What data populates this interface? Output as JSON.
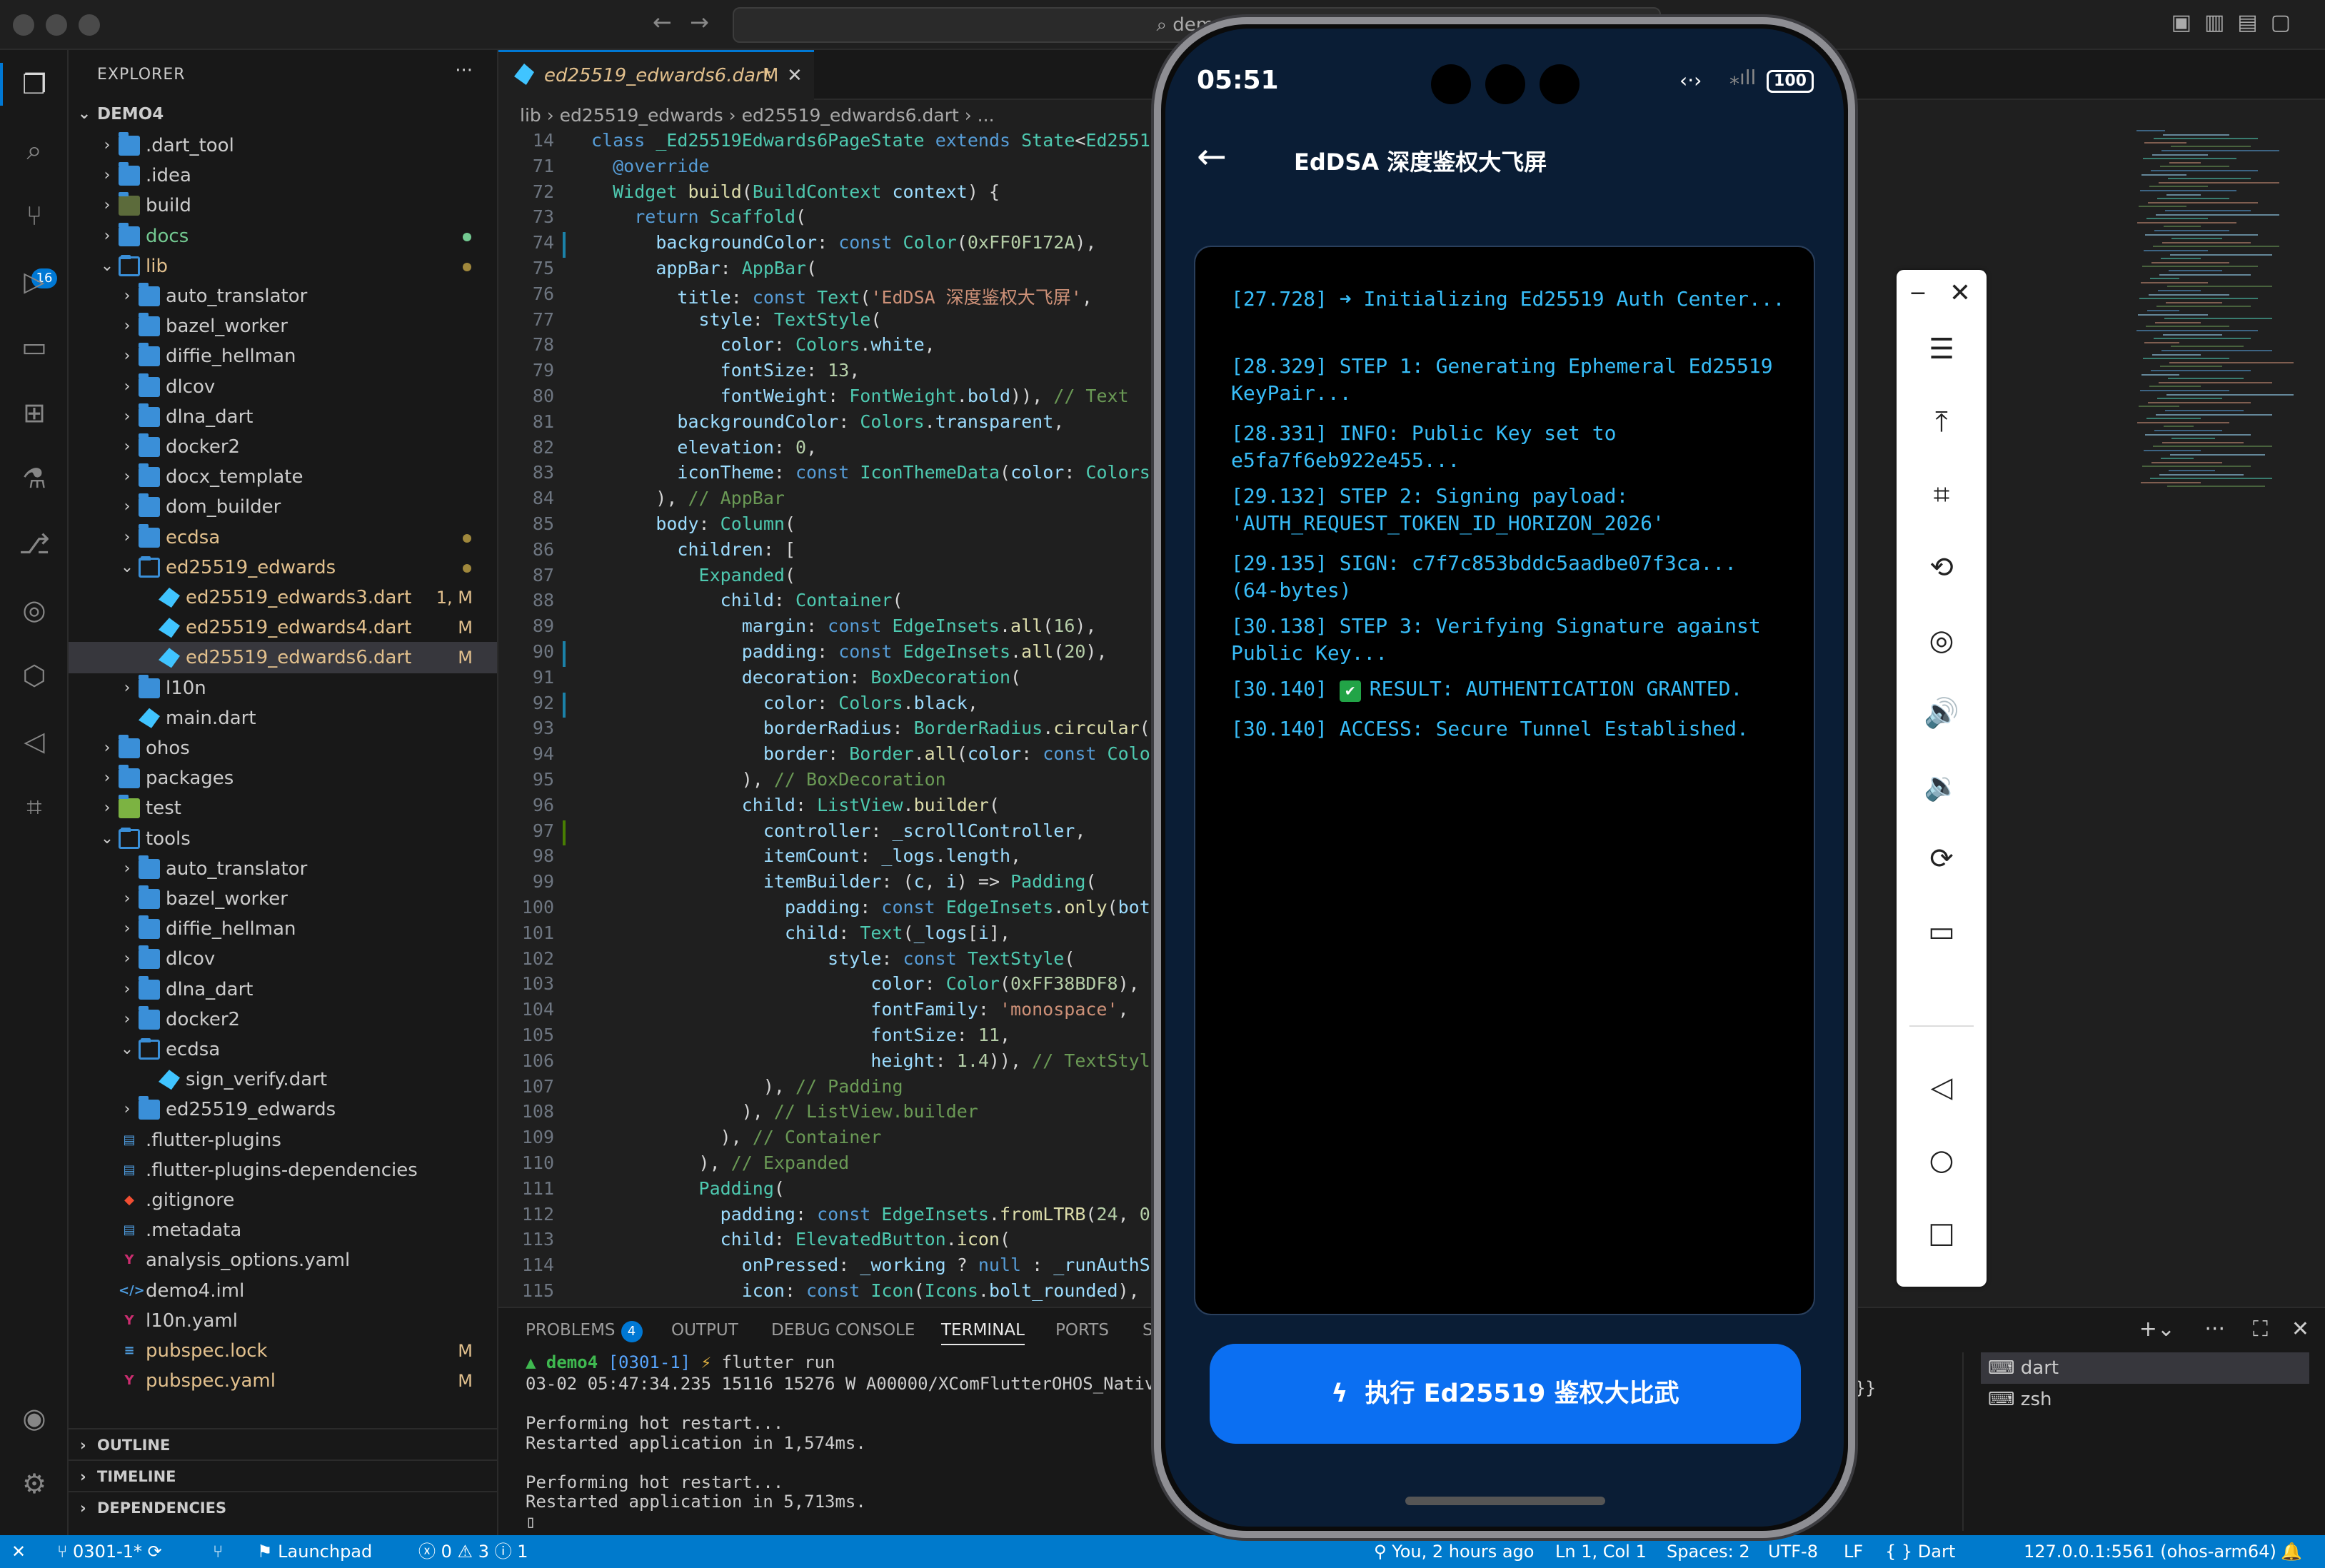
{
  "titlebar": {
    "search_text": "demo4"
  },
  "activity": {
    "scm_badge": "16"
  },
  "explorer": {
    "title": "EXPLORER",
    "root": "DEMO4",
    "items": [
      {
        "label": ".dart_tool",
        "indent": 1,
        "kind": "folder",
        "open": false
      },
      {
        "label": ".idea",
        "indent": 1,
        "kind": "folder",
        "open": false
      },
      {
        "label": "build",
        "indent": 1,
        "kind": "folder-build",
        "open": false
      },
      {
        "label": "docs",
        "indent": 1,
        "kind": "folder",
        "open": false,
        "dot": "#73c991",
        "color": "#73c991"
      },
      {
        "label": "lib",
        "indent": 1,
        "kind": "folder",
        "open": true,
        "dot": "#a0883c",
        "color": "#e2c08d"
      },
      {
        "label": "auto_translator",
        "indent": 2,
        "kind": "folder",
        "open": false
      },
      {
        "label": "bazel_worker",
        "indent": 2,
        "kind": "folder",
        "open": false
      },
      {
        "label": "diffie_hellman",
        "indent": 2,
        "kind": "folder",
        "open": false
      },
      {
        "label": "dlcov",
        "indent": 2,
        "kind": "folder",
        "open": false
      },
      {
        "label": "dlna_dart",
        "indent": 2,
        "kind": "folder",
        "open": false
      },
      {
        "label": "docker2",
        "indent": 2,
        "kind": "folder",
        "open": false
      },
      {
        "label": "docx_template",
        "indent": 2,
        "kind": "folder",
        "open": false
      },
      {
        "label": "dom_builder",
        "indent": 2,
        "kind": "folder",
        "open": false
      },
      {
        "label": "ecdsa",
        "indent": 2,
        "kind": "folder",
        "open": false,
        "dot": "#a0883c",
        "color": "#e2c08d"
      },
      {
        "label": "ed25519_edwards",
        "indent": 2,
        "kind": "folder",
        "open": true,
        "dot": "#a0883c",
        "color": "#e2c08d"
      },
      {
        "label": "ed25519_edwards3.dart",
        "indent": 3,
        "kind": "dart",
        "status": "1, M",
        "color": "#e2c08d"
      },
      {
        "label": "ed25519_edwards4.dart",
        "indent": 3,
        "kind": "dart",
        "status": "M",
        "color": "#e2c08d"
      },
      {
        "label": "ed25519_edwards6.dart",
        "indent": 3,
        "kind": "dart",
        "status": "M",
        "color": "#e2c08d",
        "selected": true
      },
      {
        "label": "l10n",
        "indent": 2,
        "kind": "folder",
        "open": false
      },
      {
        "label": "main.dart",
        "indent": 2,
        "kind": "dart"
      },
      {
        "label": "ohos",
        "indent": 1,
        "kind": "folder",
        "open": false
      },
      {
        "label": "packages",
        "indent": 1,
        "kind": "folder",
        "open": false
      },
      {
        "label": "test",
        "indent": 1,
        "kind": "folder-test",
        "open": false
      },
      {
        "label": "tools",
        "indent": 1,
        "kind": "folder",
        "open": true
      },
      {
        "label": "auto_translator",
        "indent": 2,
        "kind": "folder",
        "open": false
      },
      {
        "label": "bazel_worker",
        "indent": 2,
        "kind": "folder",
        "open": false
      },
      {
        "label": "diffie_hellman",
        "indent": 2,
        "kind": "folder",
        "open": false
      },
      {
        "label": "dlcov",
        "indent": 2,
        "kind": "folder",
        "open": false
      },
      {
        "label": "dlna_dart",
        "indent": 2,
        "kind": "folder",
        "open": false
      },
      {
        "label": "docker2",
        "indent": 2,
        "kind": "folder",
        "open": false
      },
      {
        "label": "ecdsa",
        "indent": 2,
        "kind": "folder",
        "open": true
      },
      {
        "label": "sign_verify.dart",
        "indent": 3,
        "kind": "dart"
      },
      {
        "label": "ed25519_edwards",
        "indent": 2,
        "kind": "folder",
        "open": false
      },
      {
        "label": ".flutter-plugins",
        "indent": 1,
        "kind": "file"
      },
      {
        "label": ".flutter-plugins-dependencies",
        "indent": 1,
        "kind": "file"
      },
      {
        "label": ".gitignore",
        "indent": 1,
        "kind": "git"
      },
      {
        "label": ".metadata",
        "indent": 1,
        "kind": "file"
      },
      {
        "label": "analysis_options.yaml",
        "indent": 1,
        "kind": "yaml"
      },
      {
        "label": "demo4.iml",
        "indent": 1,
        "kind": "xml"
      },
      {
        "label": "l10n.yaml",
        "indent": 1,
        "kind": "yaml"
      },
      {
        "label": "pubspec.lock",
        "indent": 1,
        "kind": "lock",
        "status": "M",
        "color": "#e2c08d"
      },
      {
        "label": "pubspec.yaml",
        "indent": 1,
        "kind": "yaml",
        "status": "M",
        "color": "#e2c08d"
      }
    ],
    "sections": [
      "OUTLINE",
      "TIMELINE",
      "DEPENDENCIES"
    ]
  },
  "editor": {
    "tab_label": "ed25519_edwards6.dart",
    "tab_status": "M",
    "breadcrumb": [
      "lib",
      "ed25519_edwards",
      "ed25519_edwards6.dart",
      "..."
    ],
    "sticky_line": {
      "no": "14",
      "html": "<span class=\"kw\">class</span> <span class=\"ty\">_Ed25519Edwards6PageState</span> <span class=\"kw\">extends</span> <span class=\"ty\">State</span>&lt;<span class=\"ty\">Ed25519E</span>"
    },
    "lines": [
      {
        "no": "71",
        "html": "  <span class=\"an\">@override</span>"
      },
      {
        "no": "72",
        "html": "  <span class=\"ty\">Widget</span> <span class=\"fn\">build</span>(<span class=\"ty\">BuildContext</span> <span class=\"pr\">context</span>) {"
      },
      {
        "no": "73",
        "html": "    <span class=\"kw\">return</span> <span class=\"ty\">Scaffold</span>("
      },
      {
        "no": "74",
        "html": "      <span class=\"pr\">backgroundColor</span>: <span class=\"kw\">const</span> <span class=\"ty\">Color</span>(<span class=\"nm\">0xFF0F172A</span>),"
      },
      {
        "no": "75",
        "html": "      <span class=\"pr\">appBar</span>: <span class=\"ty\">AppBar</span>("
      },
      {
        "no": "76",
        "html": "        <span class=\"pr\">title</span>: <span class=\"kw\">const</span> <span class=\"ty\">Text</span>(<span class=\"str\">'EdDSA 深度鉴权大飞屏'</span>,"
      },
      {
        "no": "77",
        "html": "          <span class=\"pr\">style</span>: <span class=\"ty\">TextStyle</span>("
      },
      {
        "no": "78",
        "html": "            <span class=\"pr\">color</span>: <span class=\"ty\">Colors</span>.<span class=\"pr\">white</span>,"
      },
      {
        "no": "79",
        "html": "            <span class=\"pr\">fontSize</span>: <span class=\"nm\">13</span>,"
      },
      {
        "no": "80",
        "html": "            <span class=\"pr\">fontWeight</span>: <span class=\"ty\">FontWeight</span>.<span class=\"pr\">bold</span>)), <span class=\"cm\">// Text</span>"
      },
      {
        "no": "81",
        "html": "        <span class=\"pr\">backgroundColor</span>: <span class=\"ty\">Colors</span>.<span class=\"pr\">transparent</span>,"
      },
      {
        "no": "82",
        "html": "        <span class=\"pr\">elevation</span>: <span class=\"nm\">0</span>,"
      },
      {
        "no": "83",
        "html": "        <span class=\"pr\">iconTheme</span>: <span class=\"kw\">const</span> <span class=\"ty\">IconThemeData</span>(<span class=\"pr\">color</span>: <span class=\"ty\">Colors</span>."
      },
      {
        "no": "84",
        "html": "      ), <span class=\"cm\">// AppBar</span>"
      },
      {
        "no": "85",
        "html": "      <span class=\"pr\">body</span>: <span class=\"ty\">Column</span>("
      },
      {
        "no": "86",
        "html": "        <span class=\"pr\">children</span>: ["
      },
      {
        "no": "87",
        "html": "          <span class=\"ty\">Expanded</span>("
      },
      {
        "no": "88",
        "html": "            <span class=\"pr\">child</span>: <span class=\"ty\">Container</span>("
      },
      {
        "no": "89",
        "html": "              <span class=\"pr\">margin</span>: <span class=\"kw\">const</span> <span class=\"ty\">EdgeInsets</span>.<span class=\"fn\">all</span>(<span class=\"nm\">16</span>),"
      },
      {
        "no": "90",
        "html": "              <span class=\"pr\">padding</span>: <span class=\"kw\">const</span> <span class=\"ty\">EdgeInsets</span>.<span class=\"fn\">all</span>(<span class=\"nm\">20</span>),"
      },
      {
        "no": "91",
        "html": "              <span class=\"pr\">decoration</span>: <span class=\"ty\">BoxDecoration</span>("
      },
      {
        "no": "92",
        "html": "                <span class=\"pr\">color</span>: <span class=\"ty\">Colors</span>.<span class=\"pr\">black</span>,"
      },
      {
        "no": "93",
        "html": "                <span class=\"pr\">borderRadius</span>: <span class=\"ty\">BorderRadius</span>.<span class=\"fn\">circular</span>(<span class=\"nm\">12</span>"
      },
      {
        "no": "94",
        "html": "                <span class=\"pr\">border</span>: <span class=\"ty\">Border</span>.<span class=\"fn\">all</span>(<span class=\"pr\">color</span>: <span class=\"kw\">const</span> <span class=\"ty\">Colo</span>"
      },
      {
        "no": "95",
        "html": "              ), <span class=\"cm\">// BoxDecoration</span>"
      },
      {
        "no": "96",
        "html": "              <span class=\"pr\">child</span>: <span class=\"ty\">ListView</span>.<span class=\"fn\">builder</span>("
      },
      {
        "no": "97",
        "html": "                <span class=\"pr\">controller</span>: <span class=\"pr\">_scrollController</span>,"
      },
      {
        "no": "98",
        "html": "                <span class=\"pr\">itemCount</span>: <span class=\"pr\">_logs</span>.<span class=\"pr\">length</span>,"
      },
      {
        "no": "99",
        "html": "                <span class=\"pr\">itemBuilder</span>: (<span class=\"pr\">c</span>, <span class=\"pr\">i</span>) =&gt; <span class=\"ty\">Padding</span>("
      },
      {
        "no": "100",
        "html": "                  <span class=\"pr\">padding</span>: <span class=\"kw\">const</span> <span class=\"ty\">EdgeInsets</span>.<span class=\"fn\">only</span>(<span class=\"pr\">bottom</span>"
      },
      {
        "no": "101",
        "html": "                  <span class=\"pr\">child</span>: <span class=\"ty\">Text</span>(<span class=\"pr\">_logs</span>[<span class=\"pr\">i</span>],"
      },
      {
        "no": "102",
        "html": "                      <span class=\"pr\">style</span>: <span class=\"kw\">const</span> <span class=\"ty\">TextStyle</span>("
      },
      {
        "no": "103",
        "html": "                          <span class=\"pr\">color</span>: <span class=\"ty\">Color</span>(<span class=\"nm\">0xFF38BDF8</span>),"
      },
      {
        "no": "104",
        "html": "                          <span class=\"pr\">fontFamily</span>: <span class=\"str\">'monospace'</span>,"
      },
      {
        "no": "105",
        "html": "                          <span class=\"pr\">fontSize</span>: <span class=\"nm\">11</span>,"
      },
      {
        "no": "106",
        "html": "                          <span class=\"pr\">height</span>: <span class=\"nm\">1.4</span>)), <span class=\"cm\">// TextStyle</span>"
      },
      {
        "no": "107",
        "html": "                ), <span class=\"cm\">// Padding</span>"
      },
      {
        "no": "108",
        "html": "              ), <span class=\"cm\">// ListView.builder</span>"
      },
      {
        "no": "109",
        "html": "            ), <span class=\"cm\">// Container</span>"
      },
      {
        "no": "110",
        "html": "          ), <span class=\"cm\">// Expanded</span>"
      },
      {
        "no": "111",
        "html": "          <span class=\"ty\">Padding</span>("
      },
      {
        "no": "112",
        "html": "            <span class=\"pr\">padding</span>: <span class=\"kw\">const</span> <span class=\"ty\">EdgeInsets</span>.<span class=\"fn\">fromLTRB</span>(<span class=\"nm\">24</span>, <span class=\"nm\">0</span>, <span class=\"nm\">2</span>"
      },
      {
        "no": "113",
        "html": "            <span class=\"pr\">child</span>: <span class=\"ty\">ElevatedButton</span>.<span class=\"fn\">icon</span>("
      },
      {
        "no": "114",
        "html": "              <span class=\"pr\">onPressed</span>: <span class=\"pr\">_working</span> ? <span class=\"kw\">null</span> : <span class=\"pr\">_runAuthSequ</span>"
      },
      {
        "no": "115",
        "html": "              <span class=\"pr\">icon</span>: <span class=\"kw\">const</span> <span class=\"ty\">Icon</span>(<span class=\"ty\">Icons</span>.<span class=\"pr\">bolt_rounded</span>),"
      }
    ]
  },
  "panel": {
    "tabs": [
      "PROBLEMS",
      "OUTPUT",
      "DEBUG CONSOLE",
      "TERMINAL",
      "PORTS",
      "S"
    ],
    "problems_count": "4",
    "prompt_dir": "demo4",
    "prompt_branch": "[0301-1]",
    "prompt_cmd": "flutter run",
    "lines": [
      "03-02 05:47:34.235 15116 15276 W A00000/XComFlutterOHOS_Native:",
      "",
      "Performing hot restart...",
      "Restarted application in 1,574ms.",
      "",
      "Performing hot restart...",
      "Restarted application in 5,713ms.",
      "▯"
    ],
    "overflow_tail": "}}",
    "terminals": [
      "dart",
      "zsh"
    ]
  },
  "status": {
    "branch": "0301-1*",
    "launchpad": "Launchpad",
    "errors": "0",
    "warnings": "3",
    "infos": "1",
    "blame": "You, 2 hours ago",
    "position": "Ln 1, Col 1",
    "spaces": "Spaces: 2",
    "encoding": "UTF-8",
    "eol": "LF",
    "language": "Dart",
    "device": "127.0.0.1:5561 (ohos-arm64)"
  },
  "phone": {
    "time": "05:51",
    "battery": "100",
    "app_title": "EdDSA 深度鉴权大飞屏",
    "bg_color": "#0a1d35",
    "log_color": "#38bdf8",
    "logs": [
      {
        "ts": "[27.728]",
        "icon": "➜",
        "text": "Initializing Ed25519 Auth Center...",
        "kind": "arrow"
      },
      {
        "ts": "[28.329]",
        "text": "STEP 1: Generating Ephemeral Ed25519 KeyPair..."
      },
      {
        "ts": "[28.331]",
        "text": "INFO: Public Key set to e5fa7f6eb922e455..."
      },
      {
        "ts": "[29.132]",
        "text": "STEP 2: Signing payload: 'AUTH_REQUEST_TOKEN_ID_HORIZON_2026'"
      },
      {
        "ts": "[29.135]",
        "text": "SIGN: c7f7c853bddc5aadbe07f3ca... (64-bytes)"
      },
      {
        "ts": "[30.138]",
        "text": "STEP 3: Verifying Signature against Public Key..."
      },
      {
        "ts": "[30.140]",
        "icon": "✔",
        "text": "RESULT: AUTHENTICATION GRANTED.",
        "kind": "check"
      },
      {
        "ts": "[30.140]",
        "text": "ACCESS: Secure Tunnel Established."
      }
    ],
    "button_label": "执行 Ed25519 鉴权大比武",
    "button_color": "#0b6ff2"
  }
}
